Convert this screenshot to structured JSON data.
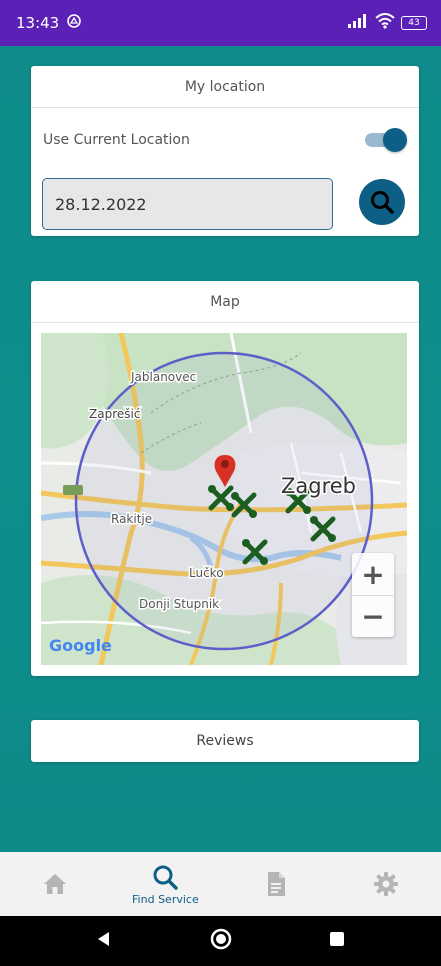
{
  "status_bar": {
    "time": "13:43",
    "battery": "43"
  },
  "location_card": {
    "title": "My location",
    "use_current_label": "Use Current Location",
    "toggle_on": true,
    "date_value": "28.12.2022"
  },
  "map_card": {
    "title": "Map",
    "places": {
      "jablanovec": "Jablanovec",
      "zapresic": "Zaprešić",
      "zagreb": "Zagreb",
      "rakitje": "Rakitje",
      "lucko": "Lučko",
      "donji_stupnik": "Donji Stupnik"
    },
    "zoom_in": "+",
    "zoom_out": "−",
    "attribution": "Google"
  },
  "reviews_card": {
    "label": "Reviews"
  },
  "bottom_nav": {
    "items": [
      {
        "icon": "home-icon",
        "label": ""
      },
      {
        "icon": "search-icon",
        "label": "Find Service"
      },
      {
        "icon": "document-icon",
        "label": ""
      },
      {
        "icon": "gear-icon",
        "label": ""
      }
    ],
    "active_index": 1
  },
  "colors": {
    "status_bar": "#5b21b6",
    "background": "#0e8c8c",
    "accent": "#0e5f86",
    "marker_red": "#d93025",
    "service_marker": "#1b5e20",
    "radius_circle": "#5c5fc9"
  }
}
